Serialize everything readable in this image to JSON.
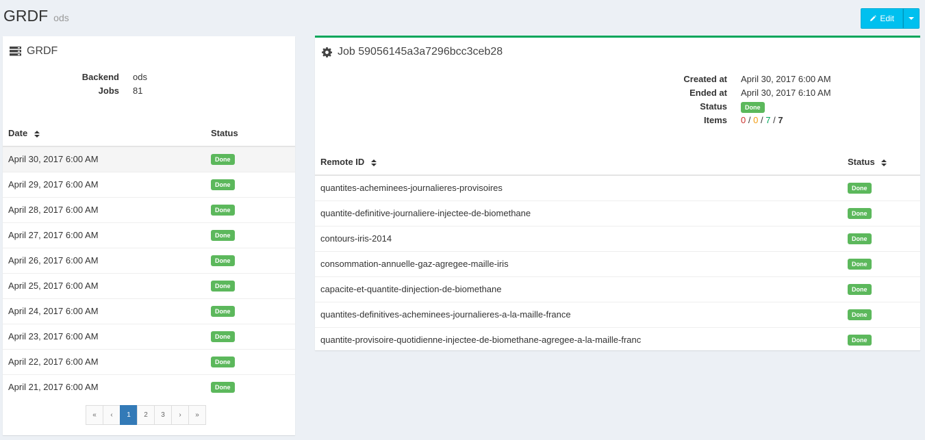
{
  "header": {
    "title": "GRDF",
    "subtitle": "ods",
    "edit_label": "Edit"
  },
  "colors": {
    "accent": "#00c0ef",
    "done": "#5cb85c",
    "box_border": "#00a65a",
    "page_active": "#337ab7"
  },
  "left_box": {
    "title": "GRDF",
    "icon": "server-icon",
    "info": [
      {
        "label": "Backend",
        "value": "ods"
      },
      {
        "label": "Jobs",
        "value": "81"
      }
    ],
    "columns": {
      "date": "Date",
      "status": "Status"
    },
    "rows": [
      {
        "date": "April 30, 2017 6:00 AM",
        "status": "Done"
      },
      {
        "date": "April 29, 2017 6:00 AM",
        "status": "Done"
      },
      {
        "date": "April 28, 2017 6:00 AM",
        "status": "Done"
      },
      {
        "date": "April 27, 2017 6:00 AM",
        "status": "Done"
      },
      {
        "date": "April 26, 2017 6:00 AM",
        "status": "Done"
      },
      {
        "date": "April 25, 2017 6:00 AM",
        "status": "Done"
      },
      {
        "date": "April 24, 2017 6:00 AM",
        "status": "Done"
      },
      {
        "date": "April 23, 2017 6:00 AM",
        "status": "Done"
      },
      {
        "date": "April 22, 2017 6:00 AM",
        "status": "Done"
      },
      {
        "date": "April 21, 2017 6:00 AM",
        "status": "Done"
      }
    ],
    "pagination": [
      "«",
      "‹",
      "1",
      "2",
      "3",
      "›",
      "»"
    ],
    "active_page": "1"
  },
  "right_box": {
    "title": "Job 59056145a3a7296bcc3ceb28",
    "icon": "gear-icon",
    "info": {
      "created_label": "Created at",
      "created_value": "April 30, 2017 6:00 AM",
      "ended_label": "Ended at",
      "ended_value": "April 30, 2017 6:10 AM",
      "status_label": "Status",
      "status_value": "Done",
      "items_label": "Items",
      "items_failed": "0",
      "items_warn": "0",
      "items_ok": "7",
      "items_total": "7",
      "sep": "/"
    },
    "columns": {
      "remote_id": "Remote ID",
      "status": "Status"
    },
    "rows": [
      {
        "remote_id": "quantites-acheminees-journalieres-provisoires",
        "status": "Done"
      },
      {
        "remote_id": "quantite-definitive-journaliere-injectee-de-biomethane",
        "status": "Done"
      },
      {
        "remote_id": "contours-iris-2014",
        "status": "Done"
      },
      {
        "remote_id": "consommation-annuelle-gaz-agregee-maille-iris",
        "status": "Done"
      },
      {
        "remote_id": "capacite-et-quantite-dinjection-de-biomethane",
        "status": "Done"
      },
      {
        "remote_id": "quantites-definitives-acheminees-journalieres-a-la-maille-france",
        "status": "Done"
      },
      {
        "remote_id": "quantite-provisoire-quotidienne-injectee-de-biomethane-agregee-a-la-maille-franc",
        "status": "Done"
      }
    ]
  }
}
